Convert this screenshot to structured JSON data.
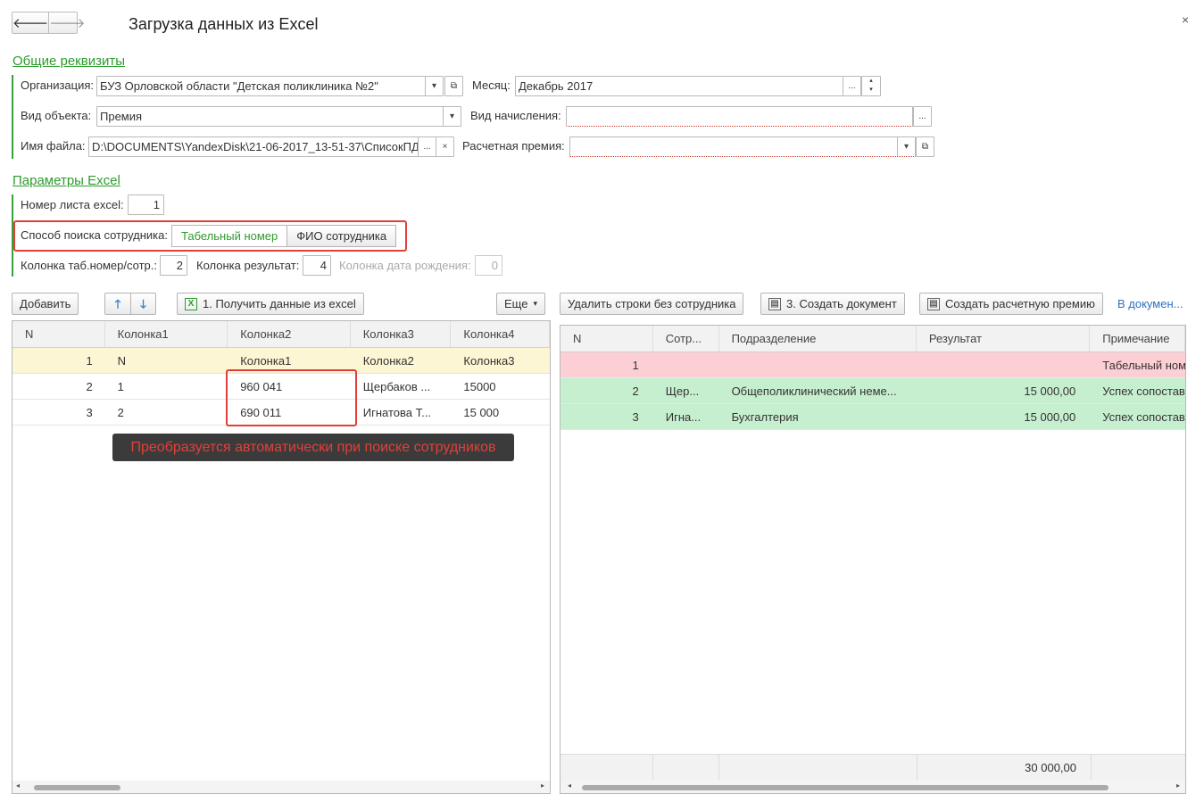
{
  "window": {
    "title": "Загрузка данных из Excel",
    "back": "🡐",
    "forward": "🡒",
    "close": "×"
  },
  "general": {
    "section": "Общие реквизиты",
    "org_label": "Организация:",
    "org_value": "БУЗ Орловской области \"Детская поликлиника №2\"",
    "month_label": "Месяц:",
    "month_value": "Декабрь 2017",
    "objtype_label": "Вид объекта:",
    "objtype_value": "Премия",
    "accrual_label": "Вид начисления:",
    "accrual_value": "",
    "file_label": "Имя файла:",
    "file_value": "D:\\DOCUMENTS\\YandexDisk\\21-06-2017_13-51-37\\СписокПД",
    "bonus_label": "Расчетная премия:",
    "bonus_value": ""
  },
  "excel": {
    "section": "Параметры Excel",
    "sheet_label": "Номер листа excel:",
    "sheet_value": "1",
    "search_label": "Способ поиска сотрудника:",
    "search_options": [
      "Табельный номер",
      "ФИО сотрудника"
    ],
    "col_tab_label": "Колонка таб.номер/сотр.:",
    "col_tab_value": "2",
    "col_res_label": "Колонка результат:",
    "col_res_value": "4",
    "col_birth_label": "Колонка дата рождения:",
    "col_birth_value": "0"
  },
  "left_toolbar": {
    "add": "Добавить",
    "get_data": "1. Получить данные из excel",
    "more": "Еще"
  },
  "right_toolbar": {
    "delete_rows": "Удалить строки без сотрудника",
    "create_doc": "3. Создать документ",
    "create_bonus": "Создать расчетную премию",
    "in_doc": "В докумен..."
  },
  "left_table": {
    "headers": [
      "N",
      "Колонка1",
      "Колонка2",
      "Колонка3",
      "Колонка4"
    ],
    "rows": [
      [
        "1",
        "N",
        "Колонка1",
        "Колонка2",
        "Колонка3"
      ],
      [
        "2",
        "1",
        "960 041",
        "Щербаков ...",
        "15000"
      ],
      [
        "3",
        "2",
        "690 011",
        "Игнатова Т...",
        "15 000"
      ]
    ]
  },
  "tooltip": "Преобразуется автоматически при поиске сотрудников",
  "right_table": {
    "headers": [
      "N",
      "Сотр...",
      "Подразделение",
      "Результат",
      "Примечание"
    ],
    "rows": [
      [
        "1",
        "",
        "",
        "",
        "Табельный ном"
      ],
      [
        "2",
        "Щер...",
        "Общеполиклинический неме...",
        "15 000,00",
        "Успех сопостав"
      ],
      [
        "3",
        "Игна...",
        "Бухгалтерия",
        "15 000,00",
        "Успех сопостав"
      ]
    ],
    "total": "30 000,00"
  },
  "colors": {
    "accent_green": "#2d9b2d",
    "error_row": "#fccfd4",
    "ok_row": "#c6efcf",
    "selected_row": "#fdf6d4",
    "highlight_red": "#e0403a"
  }
}
